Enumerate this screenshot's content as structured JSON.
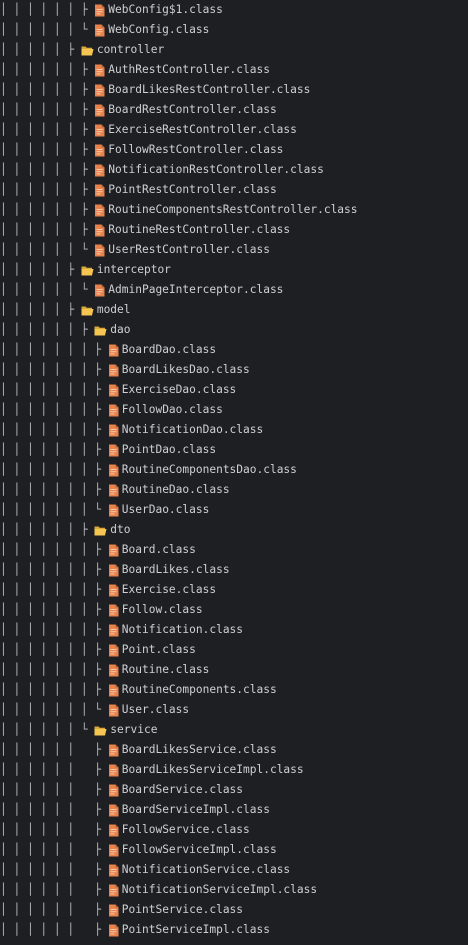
{
  "colors": {
    "background": "#1e1f22",
    "text": "#cdd0d4",
    "guide": "#b9bcc1",
    "file_icon": "#e8834e",
    "folder_icon": "#f5c451"
  },
  "rows": [
    {
      "prefix": "│ │ │ │ │ │ ├ ",
      "kind": "file",
      "icon": "java-class-file-icon",
      "label": "WebConfig$1.class"
    },
    {
      "prefix": "│ │ │ │ │ │ └ ",
      "kind": "file",
      "icon": "java-class-file-icon",
      "label": "WebConfig.class"
    },
    {
      "prefix": "│ │ │ │ │ ├ ",
      "kind": "folder",
      "icon": "folder-open-icon",
      "label": "controller"
    },
    {
      "prefix": "│ │ │ │ │ │ ├ ",
      "kind": "file",
      "icon": "java-class-file-icon",
      "label": "AuthRestController.class"
    },
    {
      "prefix": "│ │ │ │ │ │ ├ ",
      "kind": "file",
      "icon": "java-class-file-icon",
      "label": "BoardLikesRestController.class"
    },
    {
      "prefix": "│ │ │ │ │ │ ├ ",
      "kind": "file",
      "icon": "java-class-file-icon",
      "label": "BoardRestController.class"
    },
    {
      "prefix": "│ │ │ │ │ │ ├ ",
      "kind": "file",
      "icon": "java-class-file-icon",
      "label": "ExerciseRestController.class"
    },
    {
      "prefix": "│ │ │ │ │ │ ├ ",
      "kind": "file",
      "icon": "java-class-file-icon",
      "label": "FollowRestController.class"
    },
    {
      "prefix": "│ │ │ │ │ │ ├ ",
      "kind": "file",
      "icon": "java-class-file-icon",
      "label": "NotificationRestController.class"
    },
    {
      "prefix": "│ │ │ │ │ │ ├ ",
      "kind": "file",
      "icon": "java-class-file-icon",
      "label": "PointRestController.class"
    },
    {
      "prefix": "│ │ │ │ │ │ ├ ",
      "kind": "file",
      "icon": "java-class-file-icon",
      "label": "RoutineComponentsRestController.class"
    },
    {
      "prefix": "│ │ │ │ │ │ ├ ",
      "kind": "file",
      "icon": "java-class-file-icon",
      "label": "RoutineRestController.class"
    },
    {
      "prefix": "│ │ │ │ │ │ └ ",
      "kind": "file",
      "icon": "java-class-file-icon",
      "label": "UserRestController.class"
    },
    {
      "prefix": "│ │ │ │ │ ├ ",
      "kind": "folder",
      "icon": "folder-open-icon",
      "label": "interceptor"
    },
    {
      "prefix": "│ │ │ │ │ │ └ ",
      "kind": "file",
      "icon": "java-class-file-icon",
      "label": "AdminPageInterceptor.class"
    },
    {
      "prefix": "│ │ │ │ │ ├ ",
      "kind": "folder",
      "icon": "folder-open-icon",
      "label": "model"
    },
    {
      "prefix": "│ │ │ │ │ │ ├ ",
      "kind": "folder",
      "icon": "folder-open-icon",
      "label": "dao"
    },
    {
      "prefix": "│ │ │ │ │ │ │ ├ ",
      "kind": "file",
      "icon": "java-class-file-icon",
      "label": "BoardDao.class"
    },
    {
      "prefix": "│ │ │ │ │ │ │ ├ ",
      "kind": "file",
      "icon": "java-class-file-icon",
      "label": "BoardLikesDao.class"
    },
    {
      "prefix": "│ │ │ │ │ │ │ ├ ",
      "kind": "file",
      "icon": "java-class-file-icon",
      "label": "ExerciseDao.class"
    },
    {
      "prefix": "│ │ │ │ │ │ │ ├ ",
      "kind": "file",
      "icon": "java-class-file-icon",
      "label": "FollowDao.class"
    },
    {
      "prefix": "│ │ │ │ │ │ │ ├ ",
      "kind": "file",
      "icon": "java-class-file-icon",
      "label": "NotificationDao.class"
    },
    {
      "prefix": "│ │ │ │ │ │ │ ├ ",
      "kind": "file",
      "icon": "java-class-file-icon",
      "label": "PointDao.class"
    },
    {
      "prefix": "│ │ │ │ │ │ │ ├ ",
      "kind": "file",
      "icon": "java-class-file-icon",
      "label": "RoutineComponentsDao.class"
    },
    {
      "prefix": "│ │ │ │ │ │ │ ├ ",
      "kind": "file",
      "icon": "java-class-file-icon",
      "label": "RoutineDao.class"
    },
    {
      "prefix": "│ │ │ │ │ │ │ └ ",
      "kind": "file",
      "icon": "java-class-file-icon",
      "label": "UserDao.class"
    },
    {
      "prefix": "│ │ │ │ │ │ ├ ",
      "kind": "folder",
      "icon": "folder-open-icon",
      "label": "dto"
    },
    {
      "prefix": "│ │ │ │ │ │ │ ├ ",
      "kind": "file",
      "icon": "java-class-file-icon",
      "label": "Board.class"
    },
    {
      "prefix": "│ │ │ │ │ │ │ ├ ",
      "kind": "file",
      "icon": "java-class-file-icon",
      "label": "BoardLikes.class"
    },
    {
      "prefix": "│ │ │ │ │ │ │ ├ ",
      "kind": "file",
      "icon": "java-class-file-icon",
      "label": "Exercise.class"
    },
    {
      "prefix": "│ │ │ │ │ │ │ ├ ",
      "kind": "file",
      "icon": "java-class-file-icon",
      "label": "Follow.class"
    },
    {
      "prefix": "│ │ │ │ │ │ │ ├ ",
      "kind": "file",
      "icon": "java-class-file-icon",
      "label": "Notification.class"
    },
    {
      "prefix": "│ │ │ │ │ │ │ ├ ",
      "kind": "file",
      "icon": "java-class-file-icon",
      "label": "Point.class"
    },
    {
      "prefix": "│ │ │ │ │ │ │ ├ ",
      "kind": "file",
      "icon": "java-class-file-icon",
      "label": "Routine.class"
    },
    {
      "prefix": "│ │ │ │ │ │ │ ├ ",
      "kind": "file",
      "icon": "java-class-file-icon",
      "label": "RoutineComponents.class"
    },
    {
      "prefix": "│ │ │ │ │ │ │ └ ",
      "kind": "file",
      "icon": "java-class-file-icon",
      "label": "User.class"
    },
    {
      "prefix": "│ │ │ │ │ │ └ ",
      "kind": "folder",
      "icon": "folder-open-icon",
      "label": "service"
    },
    {
      "prefix": "│ │ │ │ │ │   ├ ",
      "kind": "file",
      "icon": "java-class-file-icon",
      "label": "BoardLikesService.class"
    },
    {
      "prefix": "│ │ │ │ │ │   ├ ",
      "kind": "file",
      "icon": "java-class-file-icon",
      "label": "BoardLikesServiceImpl.class"
    },
    {
      "prefix": "│ │ │ │ │ │   ├ ",
      "kind": "file",
      "icon": "java-class-file-icon",
      "label": "BoardService.class"
    },
    {
      "prefix": "│ │ │ │ │ │   ├ ",
      "kind": "file",
      "icon": "java-class-file-icon",
      "label": "BoardServiceImpl.class"
    },
    {
      "prefix": "│ │ │ │ │ │   ├ ",
      "kind": "file",
      "icon": "java-class-file-icon",
      "label": "FollowService.class"
    },
    {
      "prefix": "│ │ │ │ │ │   ├ ",
      "kind": "file",
      "icon": "java-class-file-icon",
      "label": "FollowServiceImpl.class"
    },
    {
      "prefix": "│ │ │ │ │ │   ├ ",
      "kind": "file",
      "icon": "java-class-file-icon",
      "label": "NotificationService.class"
    },
    {
      "prefix": "│ │ │ │ │ │   ├ ",
      "kind": "file",
      "icon": "java-class-file-icon",
      "label": "NotificationServiceImpl.class"
    },
    {
      "prefix": "│ │ │ │ │ │   ├ ",
      "kind": "file",
      "icon": "java-class-file-icon",
      "label": "PointService.class"
    },
    {
      "prefix": "│ │ │ │ │ │   ├ ",
      "kind": "file",
      "icon": "java-class-file-icon",
      "label": "PointServiceImpl.class"
    }
  ]
}
